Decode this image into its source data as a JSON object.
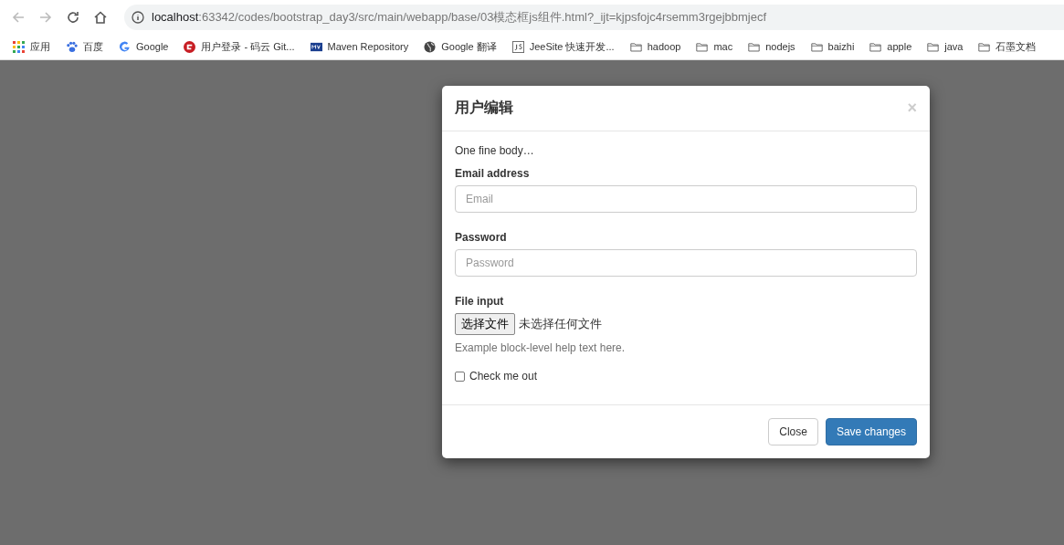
{
  "browser": {
    "address": {
      "host": "localhost",
      "path": ":63342/codes/bootstrap_day3/src/main/webapp/base/03模态框js组件.html?_ijt=kjpsfojc4rsemm3rgejbbmjecf"
    },
    "bookmarks": [
      {
        "kind": "apps",
        "label": "应用"
      },
      {
        "kind": "paw",
        "label": "百度"
      },
      {
        "kind": "google",
        "label": "Google"
      },
      {
        "kind": "gitee",
        "label": "用户登录 - 码云 Git..."
      },
      {
        "kind": "maven",
        "label": "Maven Repository"
      },
      {
        "kind": "globe",
        "label": "Google 翻译"
      },
      {
        "kind": "js",
        "label": "JeeSite 快速开发..."
      },
      {
        "kind": "folder",
        "label": "hadoop"
      },
      {
        "kind": "folder",
        "label": "mac"
      },
      {
        "kind": "folder",
        "label": "nodejs"
      },
      {
        "kind": "folder",
        "label": "baizhi"
      },
      {
        "kind": "folder",
        "label": "apple"
      },
      {
        "kind": "folder",
        "label": "java"
      },
      {
        "kind": "folder",
        "label": "石墨文档"
      }
    ]
  },
  "modal": {
    "title": "用户编辑",
    "close_symbol": "×",
    "intro": "One fine body…",
    "email": {
      "label": "Email address",
      "placeholder": "Email"
    },
    "password": {
      "label": "Password",
      "placeholder": "Password"
    },
    "file": {
      "label": "File input",
      "button": "选择文件",
      "status": "未选择任何文件",
      "help": "Example block-level help text here."
    },
    "checkbox": {
      "label": "Check me out",
      "checked": false
    },
    "buttons": [
      {
        "kind": "default",
        "label": "Close"
      },
      {
        "kind": "primary",
        "label": "Save changes"
      }
    ]
  }
}
